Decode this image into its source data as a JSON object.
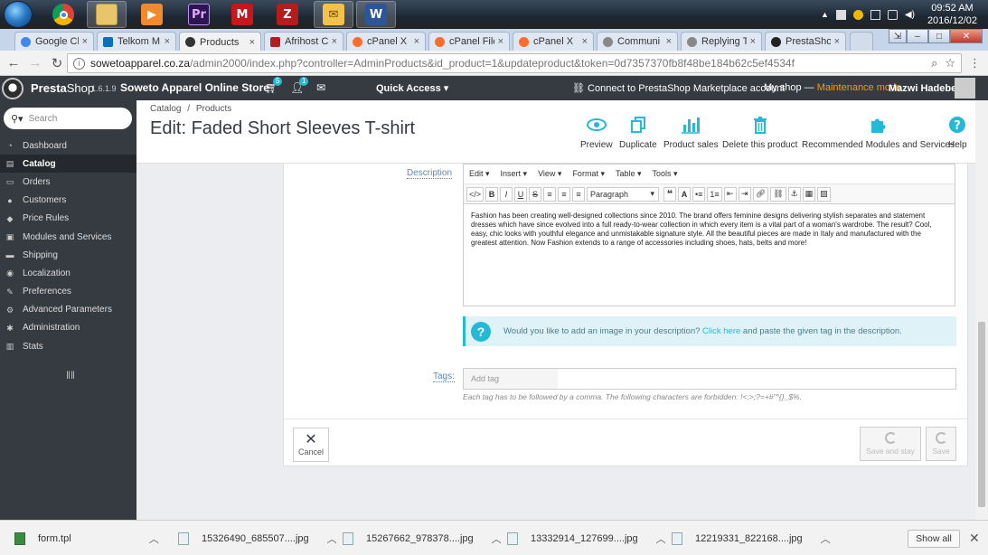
{
  "taskbar": {
    "apps": [
      {
        "name": "chrome",
        "letter": "",
        "color": "#e8b923"
      },
      {
        "name": "file-explorer",
        "letter": "",
        "color": "#e8c56a"
      },
      {
        "name": "media-player",
        "letter": "▶",
        "color": "#f08a2c"
      },
      {
        "name": "premiere",
        "letter": "Pr",
        "color": "#2a1650"
      },
      {
        "name": "m-app",
        "letter": "M",
        "color": "#c8161d"
      },
      {
        "name": "filezilla",
        "letter": "Z",
        "color": "#b51c1c"
      },
      {
        "name": "outlook",
        "letter": "✉",
        "color": "#f2c14e"
      },
      {
        "name": "word",
        "letter": "W",
        "color": "#2b579a"
      }
    ],
    "clock_time": "09:52 AM",
    "clock_date": "2016/12/02"
  },
  "browser": {
    "tabs": [
      {
        "label": "Google Ch",
        "color": "#4285f4"
      },
      {
        "label": "Telkom M",
        "color": "#0a6fb5"
      },
      {
        "label": "Products",
        "color": "#333333"
      },
      {
        "label": "Afrihost C",
        "color": "#b41d1d"
      },
      {
        "label": "cPanel X",
        "color": "#ff6c2c"
      },
      {
        "label": "cPanel File",
        "color": "#ff6c2c"
      },
      {
        "label": "cPanel X",
        "color": "#ff6c2c"
      },
      {
        "label": "Communi",
        "color": "#888888"
      },
      {
        "label": "Replying T",
        "color": "#888888"
      },
      {
        "label": "PrestaSho",
        "color": "#222222"
      }
    ],
    "url_host": "sowetoapparel.co.za",
    "url_path": "/admin2000/index.php?controller=AdminProducts&id_product=1&updateproduct&token=0d7357370fb8f48be184b62c5ef4534f"
  },
  "header": {
    "brand_presta": "Presta",
    "brand_shop": "Shop",
    "version": "1.6.1.9",
    "shop_name": "Soweto Apparel Online Store",
    "cart_badge": "5",
    "customers_badge": "1",
    "quick_access": "Quick Access ▾",
    "marketplace": "Connect to PrestaShop Marketplace account",
    "my_shop": "My shop — ",
    "maintenance": "Maintenance mode",
    "employee": "Mazwi Hadebe ▾"
  },
  "sidebar": {
    "search_placeholder": "Search",
    "items": [
      {
        "label": "Dashboard",
        "icon": "◔"
      },
      {
        "label": "Catalog",
        "icon": "▤"
      },
      {
        "label": "Orders",
        "icon": "▭"
      },
      {
        "label": "Customers",
        "icon": "●"
      },
      {
        "label": "Price Rules",
        "icon": "◆"
      },
      {
        "label": "Modules and Services",
        "icon": "▣"
      },
      {
        "label": "Shipping",
        "icon": "▬"
      },
      {
        "label": "Localization",
        "icon": "◉"
      },
      {
        "label": "Preferences",
        "icon": "✎"
      },
      {
        "label": "Advanced Parameters",
        "icon": "⚙"
      },
      {
        "label": "Administration",
        "icon": "✱"
      },
      {
        "label": "Stats",
        "icon": "▥"
      }
    ],
    "active_index": 1
  },
  "toolbar": {
    "breadcrumb_1": "Catalog",
    "breadcrumb_sep": "/",
    "breadcrumb_2": "Products",
    "title": "Edit: Faded Short Sleeves T-shirt",
    "buttons": [
      {
        "label": "Preview",
        "icon": "eye-icon"
      },
      {
        "label": "Duplicate",
        "icon": "copy-icon"
      },
      {
        "label": "Product sales",
        "icon": "bar-chart-icon"
      },
      {
        "label": "Delete this product",
        "icon": "trash-icon"
      },
      {
        "label": "Recommended Modules and Services",
        "icon": "puzzle-icon"
      },
      {
        "label": "Help",
        "icon": "help-icon"
      }
    ]
  },
  "form": {
    "description_label": "Description",
    "editor_menu": [
      "Edit ▾",
      "Insert ▾",
      "View ▾",
      "Format ▾",
      "Table ▾",
      "Tools ▾"
    ],
    "paragraph_select": "Paragraph",
    "description_text": "Fashion has been creating well-designed collections since 2010. The brand offers feminine designs delivering stylish separates and statement dresses which have since evolved into a full ready-to-wear collection in which every item is a vital part of a woman's wardrobe. The result? Cool, easy, chic looks with youthful elegance and unmistakable signature style. All the beautiful pieces are made in Italy and manufactured with the greatest attention. Now Fashion extends to a range of accessories including shoes, hats, belts and more!",
    "tip_before": "Would you like to add an image in your description? ",
    "tip_link": "Click here",
    "tip_after": " and paste the given tag in the description.",
    "tags_label": "Tags:",
    "tags_placeholder": "Add tag",
    "tags_help": "Each tag has to be followed by a comma. The following characters are forbidden: !<;>;?=+#\"°{}_$%.",
    "cancel_label": "Cancel",
    "save_stay_label": "Save and stay",
    "save_label": "Save"
  },
  "downloads": {
    "files": [
      "form.tpl",
      "15326490_685507....jpg",
      "15267662_978378....jpg",
      "13332914_127699....jpg",
      "12219331_822168....jpg"
    ],
    "show_all": "Show all"
  }
}
